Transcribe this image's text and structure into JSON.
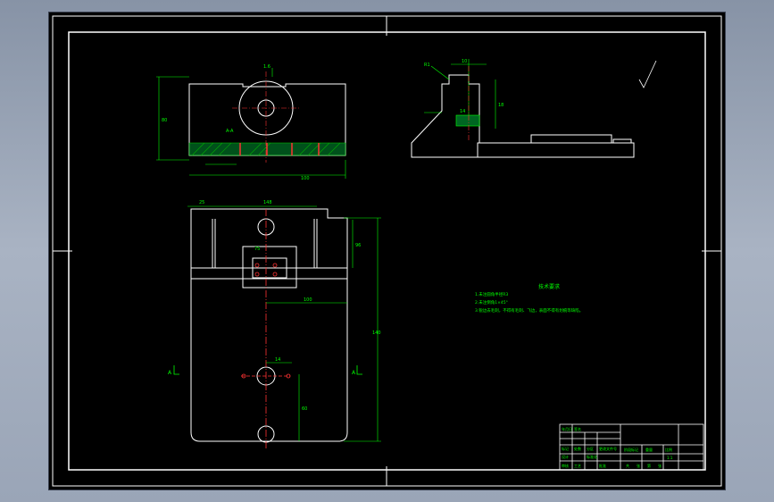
{
  "drawing": {
    "views": {
      "top": {
        "dims": [
          "1.6",
          "80",
          "148",
          "100"
        ],
        "label": "A-A"
      },
      "front": {
        "dims": [
          "96",
          "140",
          "25",
          "148",
          "100",
          "14",
          "60",
          "75",
          "128"
        ]
      },
      "side": {
        "dims": [
          "R1",
          "10",
          "18",
          "14",
          "10",
          "12"
        ]
      }
    },
    "section_marks": [
      "A",
      "A"
    ],
    "surface_note": "其余",
    "notes": {
      "title": "技术要求",
      "items": [
        "1.未注圆角半径R3",
        "2.未注倒角1×45°",
        "3.锐边去毛刺，不得有毛刺、飞边，表面不得有划痕等缺陷。"
      ]
    },
    "title_block": {
      "cells": [
        "标记",
        "处数",
        "分区",
        "更改文件号",
        "签名",
        "年月日",
        "设计",
        "标准化",
        "阶段标记",
        "重量",
        "比例",
        "审核",
        "工艺",
        "批准",
        "共",
        "张",
        "第",
        "张",
        "1:1"
      ]
    }
  }
}
